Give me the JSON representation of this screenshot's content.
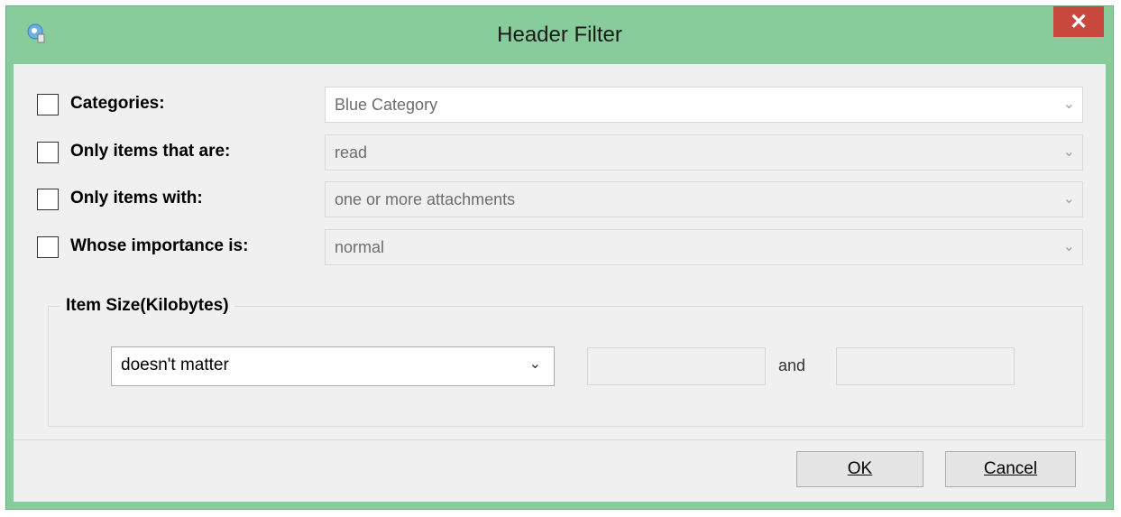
{
  "window": {
    "title": "Header Filter",
    "close_glyph": "✕",
    "app_icon": "app-icon",
    "accent_color": "#88cc9b",
    "close_color": "#c9483d"
  },
  "filters": [
    {
      "label": "Categories:",
      "value": "Blue Category",
      "checked": false
    },
    {
      "label": "Only items that are:",
      "value": "read",
      "checked": false
    },
    {
      "label": "Only items with:",
      "value": "one or more attachments",
      "checked": false
    },
    {
      "label": "Whose importance is:",
      "value": "normal",
      "checked": false
    }
  ],
  "item_size": {
    "group_label": "Item Size(Kilobytes)",
    "condition": "doesn't matter",
    "from_value": "",
    "to_value": "",
    "and_label": "and"
  },
  "buttons": {
    "ok": "OK",
    "cancel": "Cancel"
  }
}
